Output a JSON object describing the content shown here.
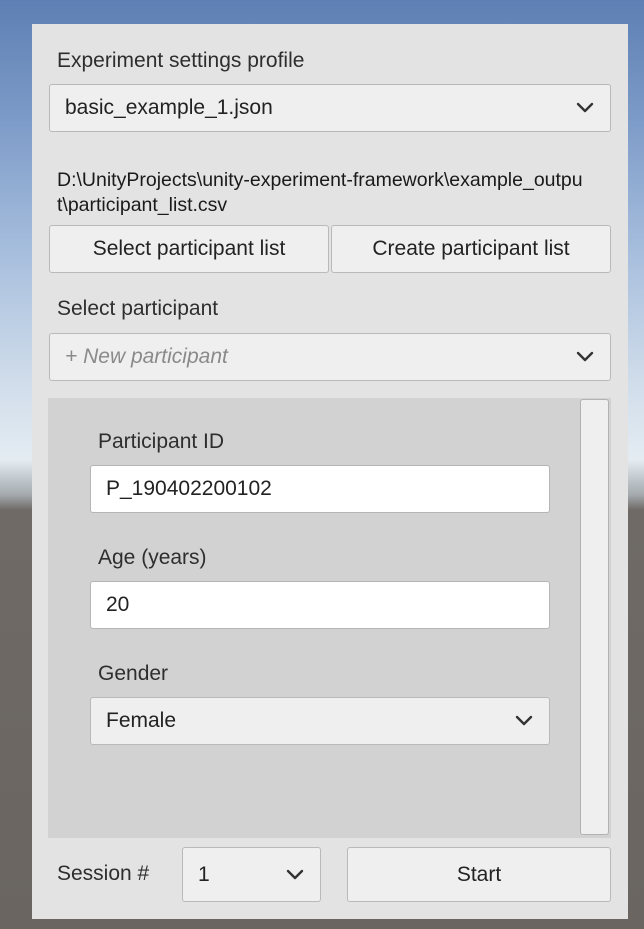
{
  "settings": {
    "profile_label": "Experiment settings profile",
    "profile_value": "basic_example_1.json"
  },
  "participant_list": {
    "path": "D:\\UnityProjects\\unity-experiment-framework\\example_output\\participant_list.csv",
    "select_button": "Select participant list",
    "create_button": "Create participant list"
  },
  "participant": {
    "select_label": "Select participant",
    "select_placeholder": "+ New participant"
  },
  "form": {
    "id_label": "Participant ID",
    "id_value": "P_190402200102",
    "age_label": "Age (years)",
    "age_value": "20",
    "gender_label": "Gender",
    "gender_value": "Female"
  },
  "footer": {
    "session_label": "Session #",
    "session_value": "1",
    "start_button": "Start"
  },
  "icons": {
    "dropdown": "chevron-down-icon"
  },
  "colors": {
    "panel_bg": "#e3e3e3",
    "inner_bg": "#d2d2d2",
    "control_bg": "#efefef",
    "field_bg": "#ffffff"
  }
}
